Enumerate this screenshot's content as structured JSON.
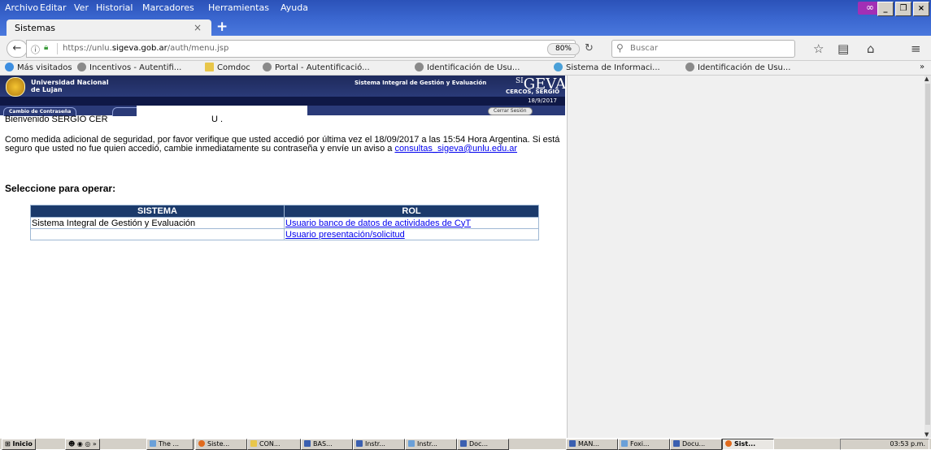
{
  "menu": [
    "Archivo",
    "Editar",
    "Ver",
    "Historial",
    "Marcadores",
    "Herramientas",
    "Ayuda"
  ],
  "tab": {
    "title": "Sistemas",
    "close": "×",
    "new": "+"
  },
  "nav": {
    "url_prefix": "https://unlu.",
    "url_domain": "sigeva.gob.ar",
    "url_path": "/auth/menu.jsp",
    "zoom": "80%",
    "search_placeholder": "Buscar"
  },
  "bookmarks": [
    "Más visitados",
    "Incentivos - Autentifi...",
    "Comdoc",
    "Portal - Autentificació...",
    "Identificación de Usu...",
    "Sistema de Informaci...",
    "Identificación de Usu..."
  ],
  "site": {
    "university_line1": "Universidad Nacional",
    "university_line2": "de Lujan",
    "system_title": "Sistema Integral de Gestión y Evaluación",
    "logo": "SIGEVA",
    "user_short": "CERCOS, SERGIO",
    "date": "18/9/2017",
    "tab_password": "Cambio de Contraseña",
    "logout": "Cerrar Sesión"
  },
  "welcome": "Bienvenido SERGIO CER",
  "welcome_tail": "U .",
  "notice": "Como medida adicional de seguridad, por favor verifique que usted accedió por última vez el 18/09/2017 a las 15:54 Hora Argentina. Si está seguro que usted no fue quien accedió, cambie inmediatamente su contraseña y envíe un aviso a",
  "notice_email": "consultas_sigeva@unlu.edu.ar",
  "heading": "Seleccione para operar:",
  "table": {
    "headers": [
      "SISTEMA",
      "ROL"
    ],
    "rows": [
      {
        "sistema": "Sistema Integral de Gestión y Evaluación",
        "rol": "Usuario banco de datos de actividades de CyT"
      },
      {
        "sistema": "",
        "rol": "Usuario presentación/solicitud"
      }
    ]
  },
  "taskbar": {
    "start": "Inicio",
    "items": [
      "The ...",
      "Siste...",
      "CON...",
      "BAS...",
      "Instr...",
      "Instr...",
      "Doc...",
      "MAN...",
      "Foxi...",
      "Docu...",
      "Sist..."
    ],
    "clock": "03:53 p.m."
  }
}
